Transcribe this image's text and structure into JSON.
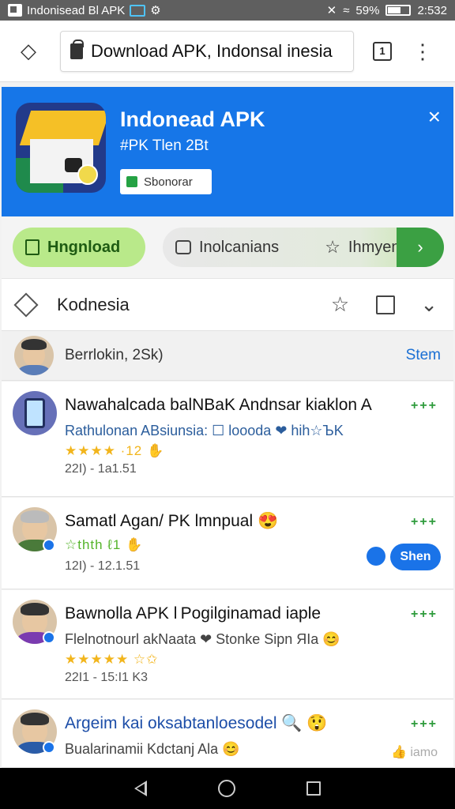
{
  "status_bar": {
    "app_title": "Indonisead Bl APK",
    "battery": "59%",
    "time": "2:532",
    "icons": [
      "app-icon",
      "tv-icon",
      "data-icon",
      "silent-icon",
      "wifi-icon",
      "signal-icon",
      "battery-icon"
    ]
  },
  "browser": {
    "site_icon": "diamond-icon",
    "url": "Download APK, Indonsal inesia",
    "tabs_count": "1"
  },
  "banner": {
    "title": "Indonead APK",
    "subtitle": "#PK Tlen 2Bt",
    "button_label": "Sbonorar",
    "close": "×",
    "bg_color": "#1676e8"
  },
  "actions": {
    "download_label": "Hngnload",
    "info_label": "Inolcanians",
    "rate_label": "Ihmyen",
    "next_glyph": "›"
  },
  "section": {
    "title": "Kodnesia"
  },
  "filter": {
    "text": "Berrlokin, 2Sk)",
    "link": "Stem"
  },
  "reviews": [
    {
      "title": "Nawahalcada balNBaK Andnsar kiaklon A",
      "desc": "Rathulonan ABsiunsia: ☐ loooda ❤ hih☆ЪK",
      "stars": "★★★★ ·12 ✋",
      "meta": "22I) - 1a1.51",
      "dots": "+++"
    },
    {
      "title": "Samatl Agan/ PK lmnpual 😍",
      "stars": "☆thth ℓ1 ✋",
      "meta": "12I) - 12.1.51",
      "dots": "+++",
      "share_label": "Shen"
    },
    {
      "title": "Bawnolla APK l Pogilginamad iaple",
      "desc": "Flelnotnourl akNaata ❤ Stonke Sipn ЯIa 😊",
      "stars": "★★★★★ ☆✩",
      "meta": "22I1 - 15:I1 K3",
      "dots": "+++"
    },
    {
      "title": "Argeim kai oksabtanloesodel 🔍 😲",
      "desc": "Bualarinamii Kdctanj Ala 😊",
      "dots": "+++",
      "thumb_label": "iamo"
    }
  ]
}
